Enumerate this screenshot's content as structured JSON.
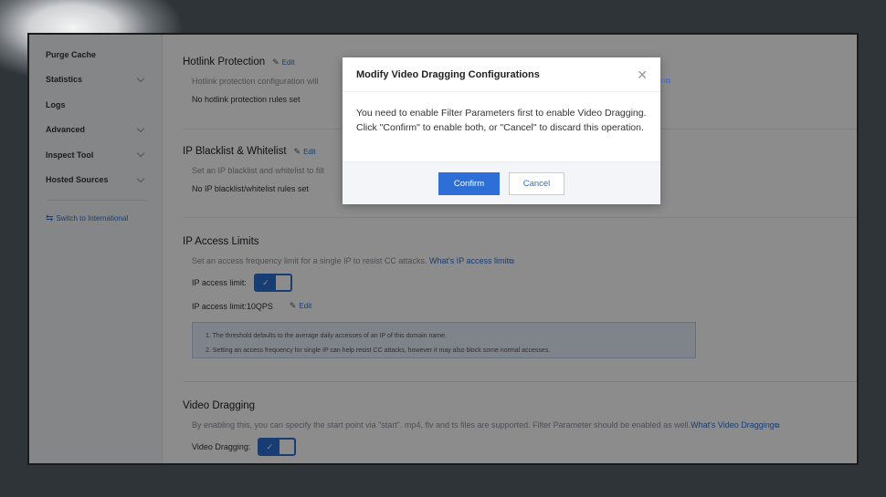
{
  "sidebar": {
    "items": [
      {
        "label": "Purge Cache",
        "has_chevron": false
      },
      {
        "label": "Statistics",
        "has_chevron": true
      },
      {
        "label": "Logs",
        "has_chevron": false
      },
      {
        "label": "Advanced",
        "has_chevron": true
      },
      {
        "label": "Inspect Tool",
        "has_chevron": true
      },
      {
        "label": "Hosted Sources",
        "has_chevron": true
      }
    ],
    "switch_label": "Switch to International"
  },
  "sections": {
    "hotlink": {
      "title": "Hotlink Protection",
      "edit": "Edit",
      "desc": "Hotlink protection configuration will",
      "value": "No hotlink protection rules set"
    },
    "ipbw": {
      "title": "IP Blacklist & Whitelist",
      "edit": "Edit",
      "desc": "Set an IP blacklist and whitelist to filt",
      "value": "No IP blacklist/whitelist rules set"
    },
    "ipaccess": {
      "title": "IP Access Limits",
      "desc": "Set an access frequency limit for a single IP to resist CC attacks.",
      "link": "What's IP access limit",
      "toggle_label": "IP access limit:",
      "value": "IP access limit:10QPS",
      "edit": "Edit",
      "notice": [
        "1. The threshold defaults to the average daily accesses of an IP of this domain name.",
        "2. Setting an access frequency for single IP can help resist CC attacks, however it may also block some normal accesses."
      ]
    },
    "videodrag": {
      "title": "Video Dragging",
      "desc": "By enabling this, you can specify the start point via \"start\". mp4, flv and ts files are supported. Filter Parameter should be enabled as well.",
      "link": "What's Video Dragging",
      "toggle_label": "Video Dragging:"
    }
  },
  "dialog": {
    "title": "Modify Video Dragging Configurations",
    "body": "You need to enable Filter Parameters first to enable Video Dragging. Click \"Confirm\" to enable both, or \"Cancel\" to discard this operation.",
    "confirm": "Confirm",
    "cancel": "Cancel"
  },
  "partial_link_fragment": "n",
  "colors": {
    "accent": "#2d6fd6",
    "overlay": "rgba(0,0,0,0.45)"
  },
  "icons": {
    "edit": "pencil-icon",
    "external": "external-link-icon",
    "close": "close-icon",
    "check": "check-icon",
    "switch": "switch-icon"
  }
}
